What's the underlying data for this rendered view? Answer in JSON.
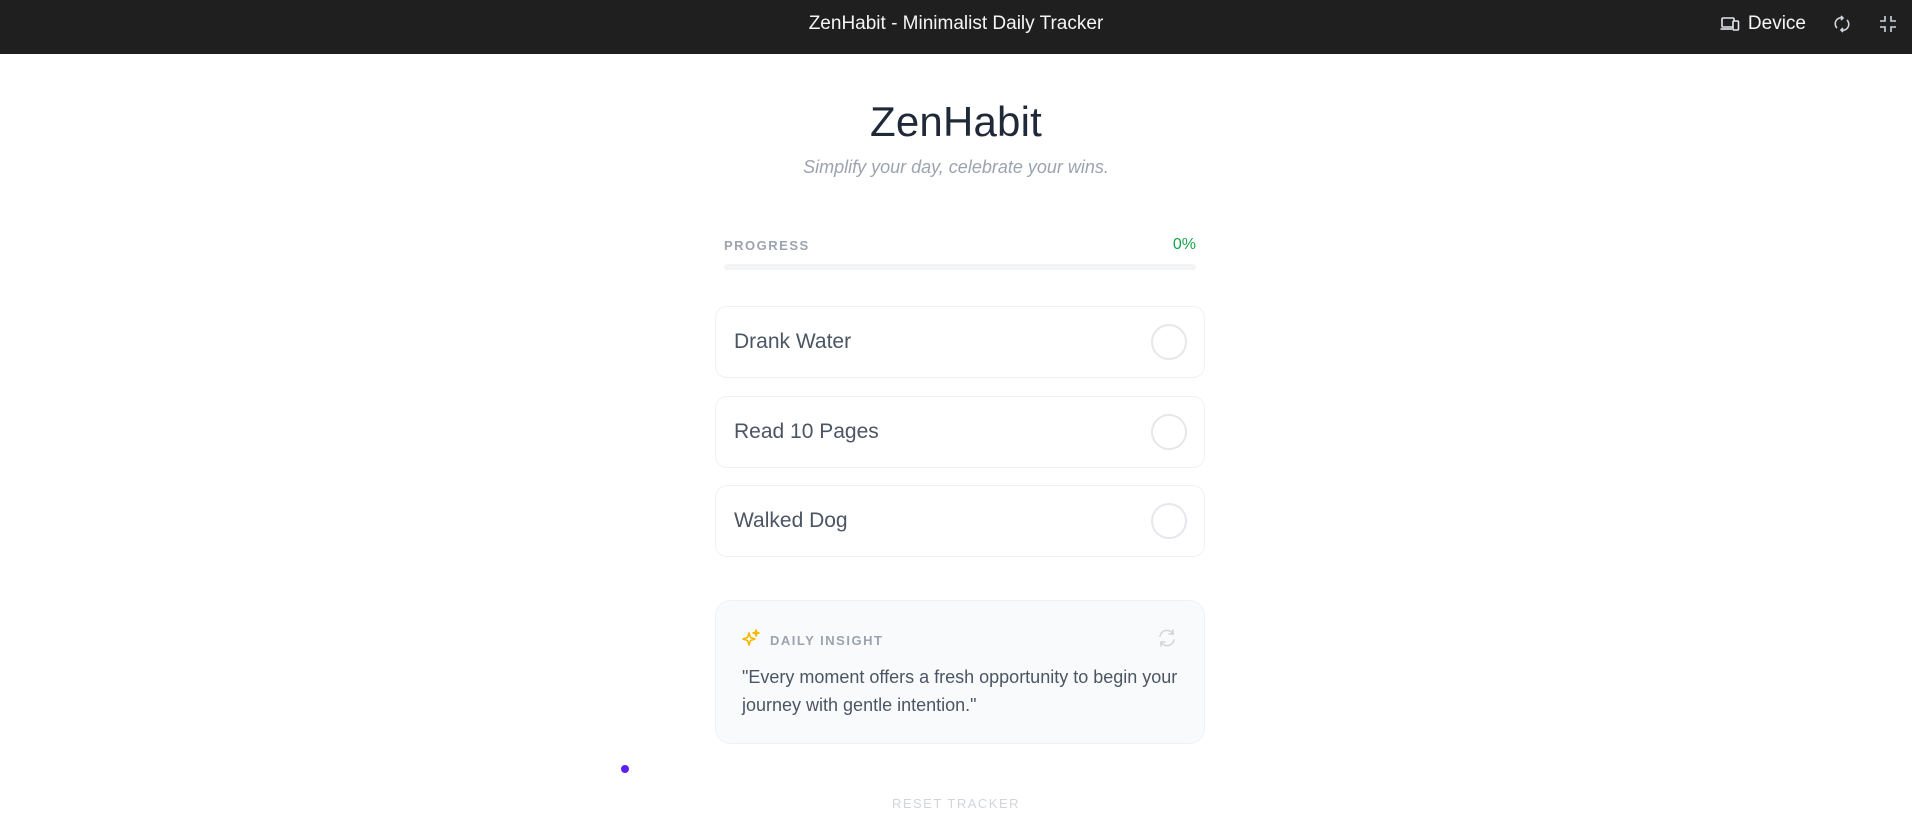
{
  "window": {
    "title": "ZenHabit - Minimalist Daily Tracker",
    "device_label": "Device",
    "icons": [
      "device-icon",
      "rotate-icon",
      "fullscreen-icon"
    ]
  },
  "header": {
    "title": "ZenHabit",
    "subtitle": "Simplify your day, celebrate your wins."
  },
  "progress": {
    "label": "PROGRESS",
    "value_text": "0%",
    "percent": 0
  },
  "habits": [
    {
      "name": "Drank Water",
      "done": false
    },
    {
      "name": "Read 10 Pages",
      "done": false
    },
    {
      "name": "Walked Dog",
      "done": false
    }
  ],
  "insight": {
    "label": "DAILY INSIGHT",
    "icon": "sparkles-icon",
    "refresh_icon": "refresh-icon",
    "quote": "\"Every moment offers a fresh opportunity to begin your journey with gentle intention.\""
  },
  "footer": {
    "reset_label": "RESET TRACKER"
  },
  "colors": {
    "accent_green": "#16a34a",
    "sparkle": "#f5b800",
    "cursor_dot": "#5b21f6",
    "topbar": "#1f1f1f"
  }
}
